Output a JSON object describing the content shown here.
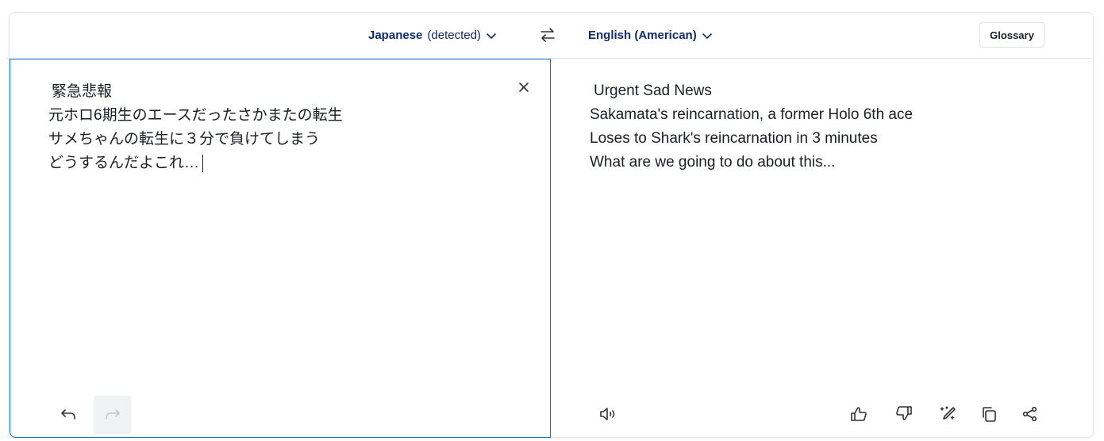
{
  "header": {
    "source_language": "Japanese",
    "source_detected": "(detected)",
    "target_language": "English (American)",
    "glossary_label": "Glossary"
  },
  "source": {
    "lines": [
      "緊急悲報",
      "元ホロ6期生のエースだったさかまたの転生",
      "サメちゃんの転生に３分で負けてしまう",
      "どうするんだよこれ…"
    ]
  },
  "target": {
    "lines": [
      "Urgent Sad News",
      "Sakamata's reincarnation, a former Holo 6th ace",
      "Loses to Shark's reincarnation in 3 minutes",
      "What are we going to do about this..."
    ]
  },
  "colors": {
    "accent": "#0f74d8",
    "language_text": "#0f2b6e"
  }
}
